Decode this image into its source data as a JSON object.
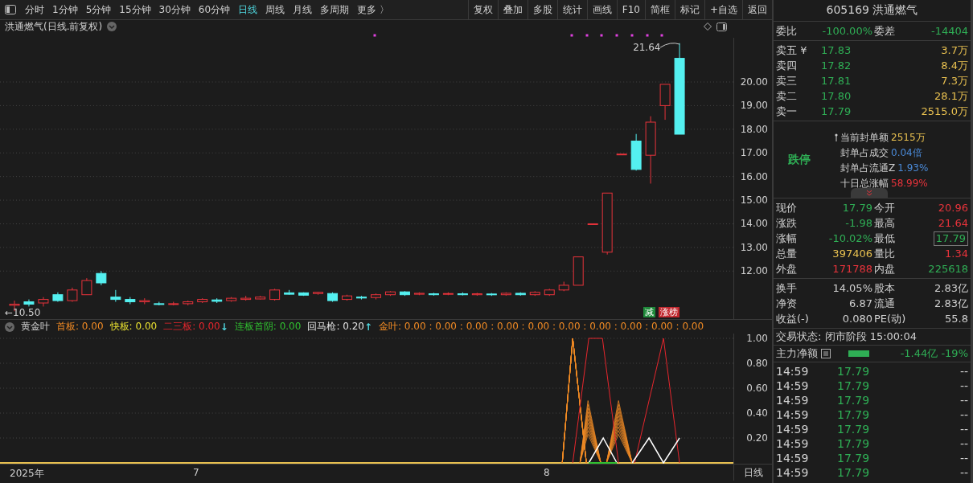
{
  "toolbar": {
    "periods": [
      {
        "label": "分时",
        "selected": false
      },
      {
        "label": "1分钟",
        "selected": false
      },
      {
        "label": "5分钟",
        "selected": false
      },
      {
        "label": "15分钟",
        "selected": false
      },
      {
        "label": "30分钟",
        "selected": false
      },
      {
        "label": "60分钟",
        "selected": false
      },
      {
        "label": "日线",
        "selected": true
      },
      {
        "label": "周线",
        "selected": false
      },
      {
        "label": "月线",
        "selected": false
      },
      {
        "label": "多周期",
        "selected": false
      },
      {
        "label": "更多 〉",
        "selected": false
      }
    ],
    "actions": [
      "复权",
      "叠加",
      "多股",
      "统计",
      "画线",
      "F10",
      "简框",
      "标记",
      "+自选",
      "返回"
    ]
  },
  "chart": {
    "title": "洪通燃气(日线.前复权)",
    "high_label": "21.64",
    "low_label": "←10.50",
    "badges": [
      {
        "label": "减",
        "color": "#1f8a3a"
      },
      {
        "label": "涨榜",
        "color": "#c0262d"
      }
    ],
    "chart_data": {
      "type": "candlestick",
      "categories": [
        null,
        null,
        null,
        null,
        null,
        null,
        null,
        null,
        null,
        null,
        null,
        null,
        null,
        null,
        null,
        null,
        null,
        null,
        null,
        null,
        null,
        null,
        null,
        null,
        null,
        null,
        null,
        null,
        null,
        null,
        null,
        null,
        null,
        null,
        null,
        null,
        null,
        null,
        null,
        null,
        null,
        null,
        null,
        null,
        null,
        null,
        null
      ],
      "ylim": [
        9.97,
        21.87
      ],
      "grid": true,
      "yticks": [
        {
          "value": 20,
          "label": "20.00"
        },
        {
          "value": 19,
          "label": "19.00"
        },
        {
          "value": 18,
          "label": "18.00"
        },
        {
          "value": 17,
          "label": "17.00"
        },
        {
          "value": 16,
          "label": "16.00"
        },
        {
          "value": 15,
          "label": "15.00"
        },
        {
          "value": 14,
          "label": "14.00"
        },
        {
          "value": 13,
          "label": "13.00"
        },
        {
          "value": 12,
          "label": "12.00"
        }
      ],
      "ohlc": [
        [
          10.55,
          10.75,
          10.3,
          10.6
        ],
        [
          10.7,
          10.8,
          10.5,
          10.6
        ],
        [
          10.65,
          10.9,
          10.5,
          10.8
        ],
        [
          11.0,
          11.1,
          10.7,
          10.75
        ],
        [
          10.75,
          11.3,
          10.7,
          11.2
        ],
        [
          11.0,
          11.7,
          11.0,
          11.6
        ],
        [
          11.9,
          12.0,
          11.4,
          11.5
        ],
        [
          10.9,
          11.2,
          10.7,
          10.8
        ],
        [
          10.8,
          10.9,
          10.6,
          10.7
        ],
        [
          10.7,
          10.85,
          10.6,
          10.75
        ],
        [
          10.62,
          10.7,
          10.55,
          10.6
        ],
        [
          10.6,
          10.7,
          10.55,
          10.62
        ],
        [
          10.62,
          10.75,
          10.55,
          10.7
        ],
        [
          10.7,
          10.85,
          10.65,
          10.8
        ],
        [
          10.78,
          10.85,
          10.65,
          10.72
        ],
        [
          10.75,
          10.9,
          10.7,
          10.85
        ],
        [
          10.8,
          10.95,
          10.75,
          10.85
        ],
        [
          10.82,
          10.95,
          10.8,
          10.9
        ],
        [
          10.8,
          11.25,
          10.75,
          11.2
        ],
        [
          11.08,
          11.2,
          11.0,
          11.02
        ],
        [
          11.08,
          11.1,
          10.95,
          10.98
        ],
        [
          11.05,
          11.12,
          11.0,
          11.1
        ],
        [
          11.05,
          11.1,
          10.7,
          10.75
        ],
        [
          10.8,
          11.0,
          10.75,
          10.95
        ],
        [
          10.9,
          10.95,
          10.8,
          10.86
        ],
        [
          10.88,
          11.05,
          10.8,
          11.0
        ],
        [
          11.0,
          11.15,
          10.95,
          11.12
        ],
        [
          11.12,
          11.15,
          10.95,
          11.0
        ],
        [
          11.02,
          11.1,
          10.98,
          11.06
        ],
        [
          11.04,
          11.08,
          10.96,
          11.0
        ],
        [
          11.02,
          11.1,
          10.98,
          11.05
        ],
        [
          11.04,
          11.1,
          10.97,
          11.0
        ],
        [
          11.0,
          11.08,
          10.96,
          11.04
        ],
        [
          11.03,
          11.07,
          10.95,
          11.0
        ],
        [
          11.0,
          11.1,
          10.96,
          11.06
        ],
        [
          11.06,
          11.1,
          10.96,
          11.0
        ],
        [
          11.0,
          11.15,
          10.95,
          11.1
        ],
        [
          11.0,
          11.25,
          10.95,
          11.2
        ],
        [
          11.2,
          11.55,
          11.15,
          11.4
        ],
        [
          11.4,
          12.6,
          11.4,
          12.6
        ],
        [
          13.97,
          14.0,
          13.97,
          14.0
        ],
        [
          12.8,
          15.3,
          12.7,
          15.3
        ],
        [
          16.92,
          16.95,
          16.92,
          16.95
        ],
        [
          17.5,
          17.8,
          16.25,
          16.3
        ],
        [
          16.9,
          18.55,
          15.7,
          18.3
        ],
        [
          19.0,
          19.9,
          18.4,
          19.9
        ],
        [
          21.0,
          21.64,
          17.79,
          17.79
        ]
      ]
    }
  },
  "indicator": {
    "name": "黄金叶",
    "params": [
      {
        "label": "首板: 0.00",
        "color": "#f08a24"
      },
      {
        "label": "快板: 0.00",
        "color": "#e8e030"
      },
      {
        "label": "二三板: 0.00",
        "color": "#e8262d",
        "arrow": "↓"
      },
      {
        "label": "连板首阴: 0.00",
        "color": "#30c030"
      },
      {
        "label": "回马枪: 0.20",
        "color": "#e0e0e0",
        "arrow": "↑"
      },
      {
        "label": "金叶: 0.00 : 0.00 : 0.00 : 0.00 : 0.00 : 0.00 : 0.00 : 0.00 : 0.00 : 0.00",
        "color": "#f08a24"
      }
    ],
    "ticks": [
      "1.00",
      "0.80",
      "0.60",
      "0.40",
      "0.20"
    ]
  },
  "time_axis": {
    "labels": [
      "2025年",
      "7",
      "8"
    ],
    "period": "日线"
  },
  "quote": {
    "header": "605169 洪通燃气",
    "ratio": {
      "label": "委比",
      "value": "-100.00%",
      "label2": "委差",
      "value2": "-14404",
      "color": "#2fae55"
    },
    "asks": [
      {
        "label": "卖五 ¥",
        "price": "17.83",
        "volume": "3.7万"
      },
      {
        "label": "卖四",
        "price": "17.82",
        "volume": "8.4万"
      },
      {
        "label": "卖三",
        "price": "17.81",
        "volume": "7.3万"
      },
      {
        "label": "卖二",
        "price": "17.80",
        "volume": "28.1万"
      },
      {
        "label": "卖一",
        "price": "17.79",
        "volume": "2515.0万"
      }
    ],
    "limit": {
      "status": "跌停",
      "lines": [
        {
          "label": "当前封单额",
          "value": "2515万",
          "color": "#e8c050",
          "pinned": true
        },
        {
          "label": "封单占成交",
          "value": "0.04倍",
          "color": "#4a8ad8",
          "pinned": false
        },
        {
          "label": "封单占流通Z",
          "value": "1.93%",
          "color": "#4a8ad8",
          "pinned": false
        },
        {
          "label": "十日总涨幅",
          "value": "58.99%",
          "color": "#e8333b",
          "pinned": false
        }
      ]
    },
    "stats": [
      {
        "left": {
          "label": "现价",
          "value": "17.79",
          "color": "#2fae55"
        },
        "right": {
          "label": "今开",
          "value": "20.96",
          "color": "#e8333b",
          "boxed": false
        }
      },
      {
        "left": {
          "label": "涨跌",
          "value": "-1.98",
          "color": "#2fae55"
        },
        "right": {
          "label": "最高",
          "value": "21.64",
          "color": "#e8333b",
          "boxed": false
        }
      },
      {
        "left": {
          "label": "涨幅",
          "value": "-10.02%",
          "color": "#2fae55"
        },
        "right": {
          "label": "最低",
          "value": "17.79",
          "color": "#2fae55",
          "boxed": true
        }
      },
      {
        "left": {
          "label": "总量",
          "value": "397406",
          "color": "#e8c050"
        },
        "right": {
          "label": "量比",
          "value": "1.34",
          "color": "#e8333b",
          "boxed": false
        }
      },
      {
        "left": {
          "label": "外盘",
          "value": "171788",
          "color": "#e8333b"
        },
        "right": {
          "label": "内盘",
          "value": "225618",
          "color": "#2fae55",
          "boxed": false
        }
      }
    ],
    "basics": [
      {
        "label": "换手",
        "value": "14.05%",
        "label2": "股本",
        "value2": "2.83亿"
      },
      {
        "label": "净资",
        "value": "6.87",
        "label2": "流通",
        "value2": "2.83亿"
      },
      {
        "label": "收益(-)",
        "value": "0.080",
        "label2": "PE(动)",
        "value2": "55.8"
      }
    ],
    "trade_status": "交易状态: 闭市阶段 15:00:04",
    "flow": {
      "label": "主力净额",
      "value": "-1.44亿 -19%"
    },
    "trades": [
      {
        "time": "14:59",
        "price": "17.79",
        "flag": "--"
      },
      {
        "time": "14:59",
        "price": "17.79",
        "flag": "--"
      },
      {
        "time": "14:59",
        "price": "17.79",
        "flag": "--"
      },
      {
        "time": "14:59",
        "price": "17.79",
        "flag": "--"
      },
      {
        "time": "14:59",
        "price": "17.79",
        "flag": "--"
      },
      {
        "time": "14:59",
        "price": "17.79",
        "flag": "--"
      },
      {
        "time": "14:59",
        "price": "17.79",
        "flag": "--"
      },
      {
        "time": "14:59",
        "price": "17.79",
        "flag": "--"
      }
    ]
  }
}
